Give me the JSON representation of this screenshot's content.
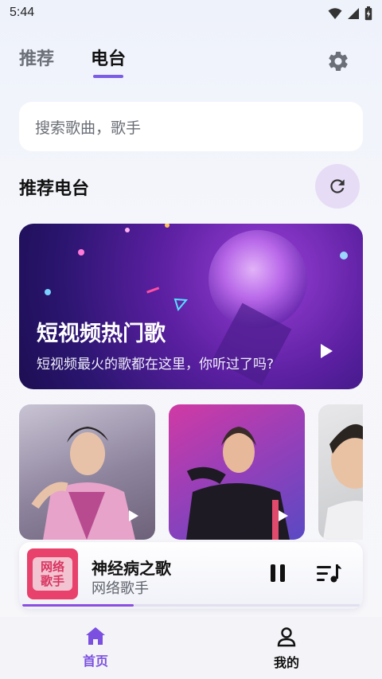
{
  "status_bar": {
    "time": "5:44",
    "icons": [
      "wifi-icon",
      "cell-signal-icon",
      "battery-icon"
    ]
  },
  "top_tabs": {
    "items": [
      {
        "label": "推荐",
        "active": false
      },
      {
        "label": "电台",
        "active": true
      }
    ],
    "settings_icon": "gear-icon"
  },
  "search": {
    "placeholder": "搜索歌曲，歌手"
  },
  "section": {
    "title": "推荐电台",
    "refresh_icon": "refresh-icon"
  },
  "banner": {
    "title": "短视频热门歌",
    "subtitle": "短视频最火的歌都在这里，你听过了吗?"
  },
  "cards": [
    {
      "image": "artist-photo-male"
    },
    {
      "image": "artist-photo-female"
    },
    {
      "image": "artist-photo-partial"
    }
  ],
  "player": {
    "cover_text": "网络歌手",
    "title": "神经病之歌",
    "artist": "网络歌手",
    "progress": 0.33,
    "pause_icon": "pause-icon",
    "playlist_icon": "playlist-icon"
  },
  "bottom_nav": {
    "items": [
      {
        "label": "首页",
        "icon": "home-icon",
        "active": true
      },
      {
        "label": "我的",
        "icon": "user-icon",
        "active": false
      }
    ]
  },
  "colors": {
    "accent": "#7b5ce6",
    "active_nav": "#7b50e0",
    "refresh_bg": "#e7dcf5"
  }
}
